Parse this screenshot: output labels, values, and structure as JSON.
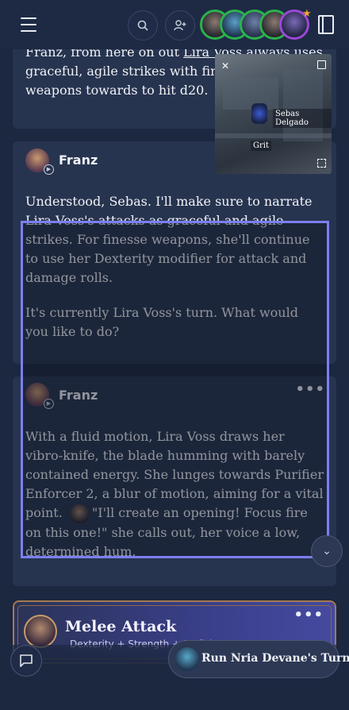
{
  "card1": {
    "lines": [
      "Franz, from here on out Lira Voss always uses",
      "graceful, agile strikes with finesse",
      "weapons towards to hit d20."
    ],
    "underlined": "Lira Voss"
  },
  "video": {
    "participant_label": "Sebas Delgado",
    "second_label": "Grit"
  },
  "card2": {
    "author": "Franz",
    "paragraph1": "Understood, Sebas. I'll make sure to narrate Lira Voss's attacks as graceful and agile strikes. For finesse weapons, she'll continue to use her Dexterity modifier for attack and damage rolls.",
    "paragraph2": "It's currently Lira Voss's turn. What would you like to do?"
  },
  "card3": {
    "author": "Franz",
    "menu": "•••",
    "text_before": "With a fluid motion, Lira Voss draws her vibro-knife, the blade humming with barely contained energy. She lunges towards Purifier Enforcer 2, a blur of motion, aiming for a vital point.",
    "text_after": "\"I'll create an opening! Focus fire on this one!\"  she calls out, her voice a low, determined hum."
  },
  "melee": {
    "title": "Melee Attack",
    "subtitle": "Dexterity + Strength + Proficiency",
    "menu": "•••"
  },
  "bottom": {
    "run_button": "Run Nria Devane's Turn"
  },
  "icons": {
    "menu": "hamburger-icon",
    "search": "search-icon",
    "add_user": "add-user-icon",
    "book": "book-icon",
    "chat": "chat-icon",
    "scroll_down": "chevron-down-icon"
  }
}
